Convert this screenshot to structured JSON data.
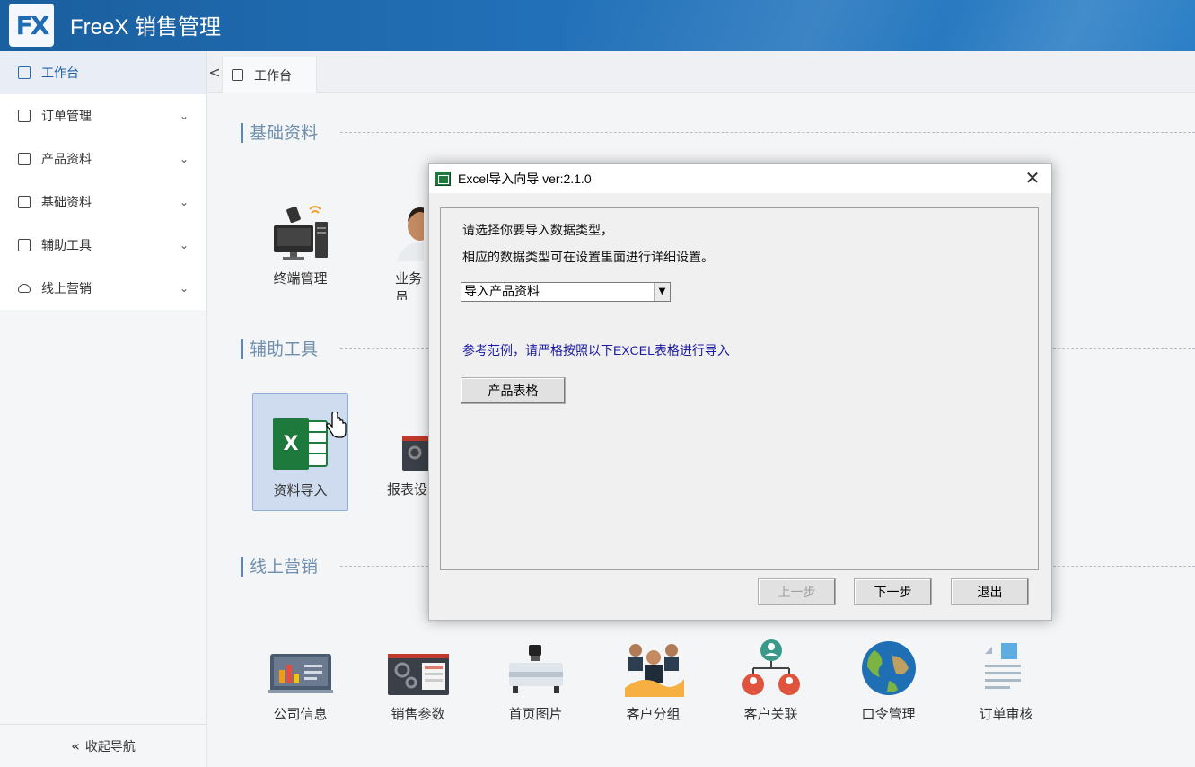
{
  "header": {
    "logo_text": "FX",
    "title": "FreeX 销售管理"
  },
  "sidebar": {
    "items": [
      {
        "label": "工作台",
        "icon": "dashboard-icon"
      },
      {
        "label": "订单管理",
        "icon": "order-icon",
        "chevron": "⌄"
      },
      {
        "label": "产品资料",
        "icon": "product-icon",
        "chevron": "⌄"
      },
      {
        "label": "基础资料",
        "icon": "basic-data-icon",
        "chevron": "⌄"
      },
      {
        "label": "辅助工具",
        "icon": "tools-icon",
        "chevron": "⌄"
      },
      {
        "label": "线上营销",
        "icon": "cloud-icon",
        "chevron": "⌄"
      }
    ],
    "collapse_label": "收起导航",
    "collapse_glyph": "«"
  },
  "tabs": {
    "back_glyph": "<",
    "items": [
      {
        "label": "工作台"
      }
    ]
  },
  "sections": {
    "basic": {
      "title": "基础资料",
      "tiles": [
        "终端管理",
        "业务员"
      ]
    },
    "tools": {
      "title": "辅助工具",
      "tiles": [
        "资料导入",
        "报表设"
      ]
    },
    "marketing": {
      "title": "线上营销",
      "tiles": [
        "公司信息",
        "销售参数",
        "首页图片",
        "客户分组",
        "客户关联",
        "口令管理",
        "订单审核"
      ]
    }
  },
  "dialog": {
    "title": "Excel导入向导  ver:2.1.0",
    "close_glyph": "✕",
    "line1": "请选择你要导入数据类型，",
    "line2": "相应的数据类型可在设置里面进行详细设置。",
    "select_value": "导入产品资料",
    "select_arrow": "▼",
    "hint": "参考范例，请严格按照以下EXCEL表格进行导入",
    "sample_button": "产品表格",
    "prev_button": "上一步",
    "next_button": "下一步",
    "exit_button": "退出"
  },
  "colors": {
    "header": "#2270b8",
    "accent": "#1f5fa8",
    "excel_green": "#1e7a3c"
  }
}
